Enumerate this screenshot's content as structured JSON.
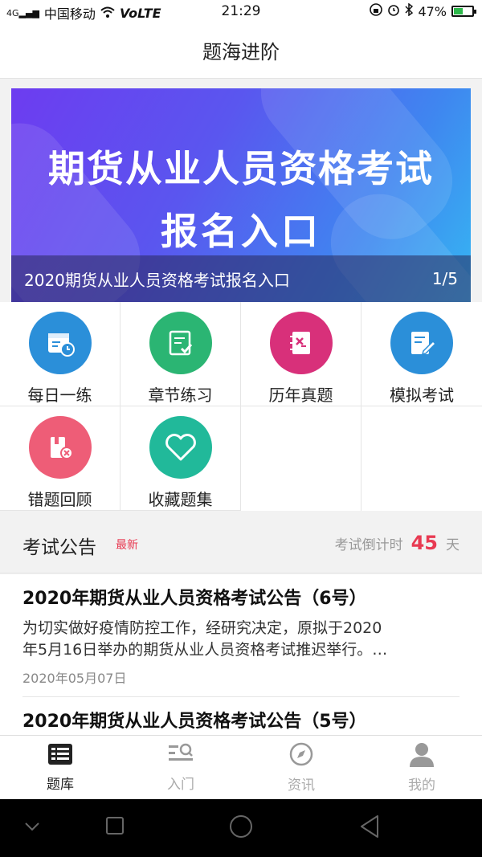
{
  "status_bar": {
    "carrier": "中国移动",
    "network": "VoLTE",
    "time": "21:29",
    "battery": "47%",
    "battery_level": 0.47,
    "signal_tag": "4G"
  },
  "header": {
    "title": "题海进阶"
  },
  "banner": {
    "line1": "期货从业人员资格考试",
    "line2": "报名入口",
    "caption": "2020期货从业人员资格考试报名入口",
    "pager": "1/5"
  },
  "grid": {
    "items": [
      {
        "label": "每日一练",
        "icon": "calendar-clock-icon",
        "color": "#2b8fd9"
      },
      {
        "label": "章节练习",
        "icon": "checklist-icon",
        "color": "#2bb573"
      },
      {
        "label": "历年真题",
        "icon": "notebook-icon",
        "color": "#d8307a"
      },
      {
        "label": "模拟考试",
        "icon": "edit-document-icon",
        "color": "#2b8fd9"
      },
      {
        "label": "错题回顾",
        "icon": "error-book-icon",
        "color": "#ee5d77"
      },
      {
        "label": "收藏题集",
        "icon": "heart-icon",
        "color": "#21b99a"
      }
    ]
  },
  "notice": {
    "title": "考试公告",
    "badge": "最新",
    "countdown_prefix": "考试倒计时",
    "countdown_value": "45",
    "countdown_unit": "天"
  },
  "articles": [
    {
      "title": "2020年期货从业人员资格考试公告（6号）",
      "body_line1": "为切实做好疫情防控工作，经研究决定，原拟于2020",
      "body_line2": "年5月16日举办的期货从业人员资格考试推迟举行。…",
      "date": "2020年05月07日"
    },
    {
      "title": "2020年期货从业人员资格考试公告（5号）"
    }
  ],
  "tabs": [
    {
      "label": "题库",
      "icon": "question-bank-icon",
      "active": true
    },
    {
      "label": "入门",
      "icon": "search-list-icon",
      "active": false
    },
    {
      "label": "资讯",
      "icon": "compass-icon",
      "active": false
    },
    {
      "label": "我的",
      "icon": "person-icon",
      "active": false
    }
  ],
  "colors": {
    "accent_red": "#e83a52",
    "active_tab": "#222222",
    "inactive_tab": "#aaaaaa"
  }
}
